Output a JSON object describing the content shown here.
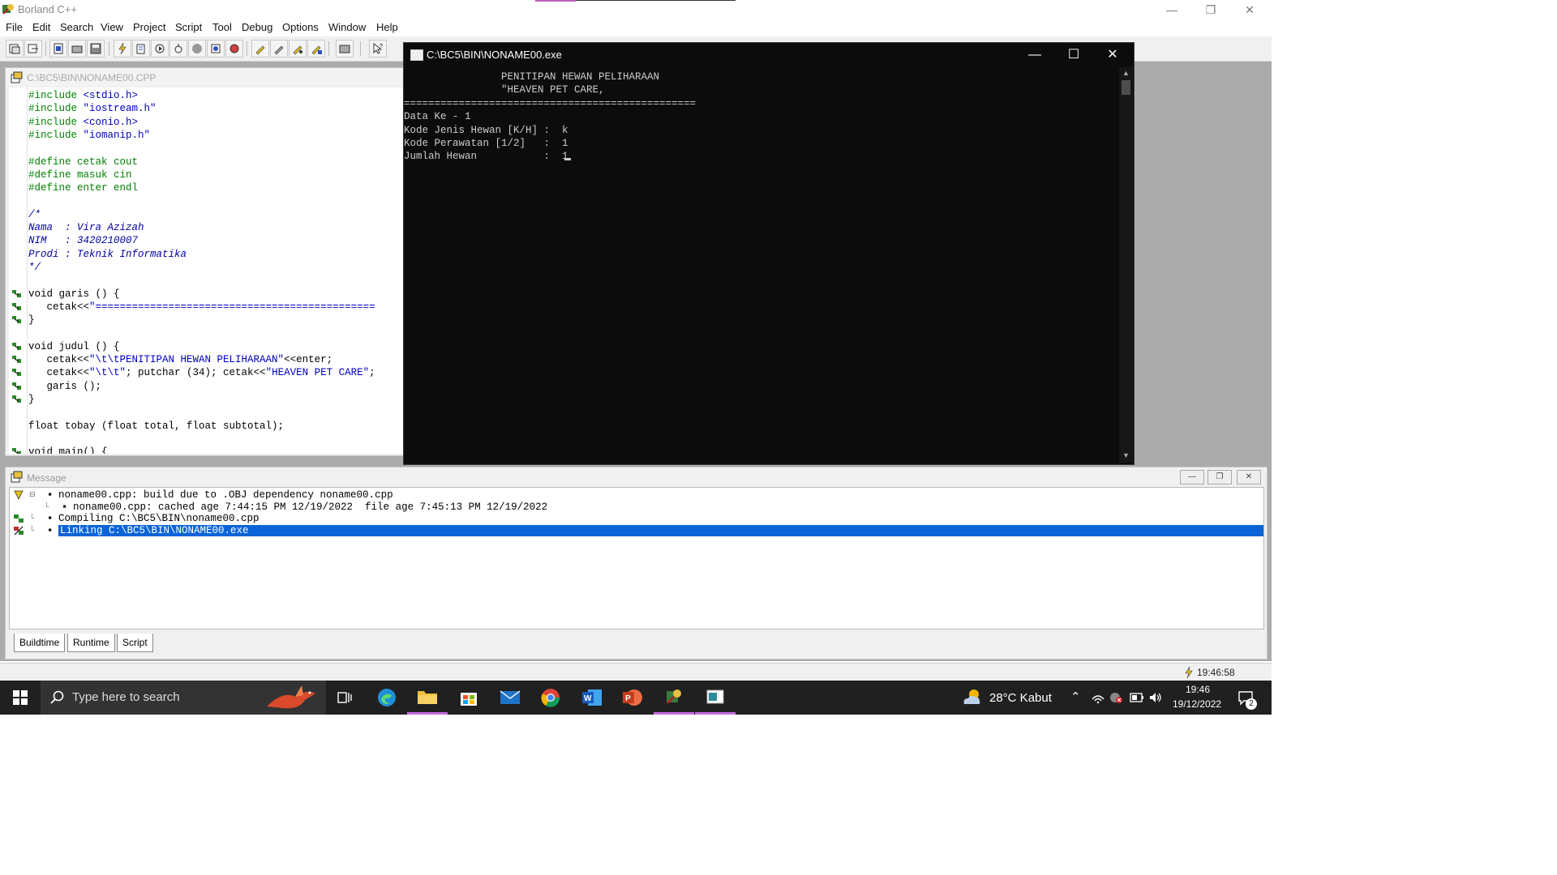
{
  "window": {
    "title": "Borland C++"
  },
  "menu": [
    "File",
    "Edit",
    "Search",
    "View",
    "Project",
    "Script",
    "Tool",
    "Debug",
    "Options",
    "Window",
    "Help"
  ],
  "toolbar_icons": [
    "new-project-icon",
    "open-project-icon",
    "new-file-icon",
    "open-file-icon",
    "save-icon",
    "save-all-icon",
    "make-icon",
    "build-icon",
    "run-icon",
    "step-over-icon",
    "trace-into-icon",
    "stop-icon",
    "reset-icon",
    "breakpoint-icon",
    "inspect-icon",
    "evaluate-icon",
    "watch-icon",
    "browse-icon",
    "help-pointer-icon"
  ],
  "editor": {
    "title": "C:\\BC5\\BIN\\NONAME00.CPP",
    "lines": [
      {
        "segs": [
          [
            "dir",
            "#include "
          ],
          [
            "str",
            "<stdio.h>"
          ]
        ]
      },
      {
        "segs": [
          [
            "dir",
            "#include "
          ],
          [
            "str",
            "\"iostream.h\""
          ]
        ]
      },
      {
        "segs": [
          [
            "dir",
            "#include "
          ],
          [
            "str",
            "<conio.h>"
          ]
        ]
      },
      {
        "segs": [
          [
            "dir",
            "#include "
          ],
          [
            "str",
            "\"iomanip.h\""
          ]
        ]
      },
      {
        "segs": []
      },
      {
        "segs": [
          [
            "dir",
            "#define cetak cout"
          ]
        ]
      },
      {
        "segs": [
          [
            "dir",
            "#define masuk cin"
          ]
        ]
      },
      {
        "segs": [
          [
            "dir",
            "#define enter endl"
          ]
        ]
      },
      {
        "segs": []
      },
      {
        "segs": [
          [
            "com",
            "/*"
          ]
        ]
      },
      {
        "segs": [
          [
            "com",
            "Nama  : Vira Azizah"
          ]
        ]
      },
      {
        "segs": [
          [
            "com",
            "NIM   : 3420210007"
          ]
        ]
      },
      {
        "segs": [
          [
            "com",
            "Prodi : Teknik Informatika"
          ]
        ]
      },
      {
        "segs": [
          [
            "com",
            "*/"
          ]
        ]
      },
      {
        "segs": []
      },
      {
        "segs": [
          [
            "txt",
            "void garis () {"
          ]
        ],
        "gutter": true
      },
      {
        "segs": [
          [
            "txt",
            "   cetak<<"
          ],
          [
            "str",
            "\"=============================================="
          ]
        ],
        "gutter": true
      },
      {
        "segs": [
          [
            "txt",
            "}"
          ]
        ],
        "gutter": true
      },
      {
        "segs": []
      },
      {
        "segs": [
          [
            "txt",
            "void judul () {"
          ]
        ],
        "gutter": true
      },
      {
        "segs": [
          [
            "txt",
            "   cetak<<"
          ],
          [
            "str",
            "\"\\t\\tPENITIPAN HEWAN PELIHARAAN\""
          ],
          [
            "txt",
            "<<enter;"
          ]
        ],
        "gutter": true
      },
      {
        "segs": [
          [
            "txt",
            "   cetak<<"
          ],
          [
            "str",
            "\"\\t\\t\""
          ],
          [
            "txt",
            "; putchar (34); cetak<<"
          ],
          [
            "str",
            "\"HEAVEN PET CARE\""
          ],
          [
            "txt",
            ";"
          ]
        ],
        "gutter": true
      },
      {
        "segs": [
          [
            "txt",
            "   garis ();"
          ]
        ],
        "gutter": true
      },
      {
        "segs": [
          [
            "txt",
            "}"
          ]
        ],
        "gutter": true
      },
      {
        "segs": []
      },
      {
        "segs": [
          [
            "txt",
            "float tobay (float total, float subtotal);"
          ]
        ]
      },
      {
        "segs": []
      },
      {
        "segs": [
          [
            "txt",
            "void main() {"
          ]
        ],
        "gutter": true
      }
    ]
  },
  "console": {
    "title": "C:\\BC5\\BIN\\NONAME00.exe",
    "lines": [
      "                PENITIPAN HEWAN PELIHARAAN",
      "                \"HEAVEN PET CARE,",
      "================================================",
      "Data Ke - 1",
      "Kode Jenis Hewan [K/H] :  k",
      "Kode Perawatan [1/2]   :  1",
      "Jumlah Hewan           :  1"
    ]
  },
  "message": {
    "title": "Message",
    "lines": [
      {
        "text": "noname00.cpp: build due to .OBJ dependency noname00.cpp",
        "indent": 0
      },
      {
        "text": "noname00.cpp: cached age 7:44:15 PM 12/19/2022  file age 7:45:13 PM 12/19/2022",
        "indent": 1
      },
      {
        "text": "Compiling C:\\BC5\\BIN\\noname00.cpp",
        "indent": 0
      },
      {
        "text": "Linking C:\\BC5\\BIN\\NONAME00.exe",
        "indent": 0,
        "selected": true
      }
    ],
    "tabs": [
      "Buildtime",
      "Runtime",
      "Script"
    ]
  },
  "status": {
    "time": "19:46:58"
  },
  "taskbar": {
    "search_placeholder": "Type here to search",
    "weather": "28°C  Kabut",
    "clock_time": "19:46",
    "clock_date": "19/12/2022",
    "notification_count": "2"
  },
  "colors": {
    "selection": "#0a64d8",
    "directive": "#008000",
    "string": "#0000c0",
    "comment": "#0000a0",
    "accent": "#c56de0"
  }
}
